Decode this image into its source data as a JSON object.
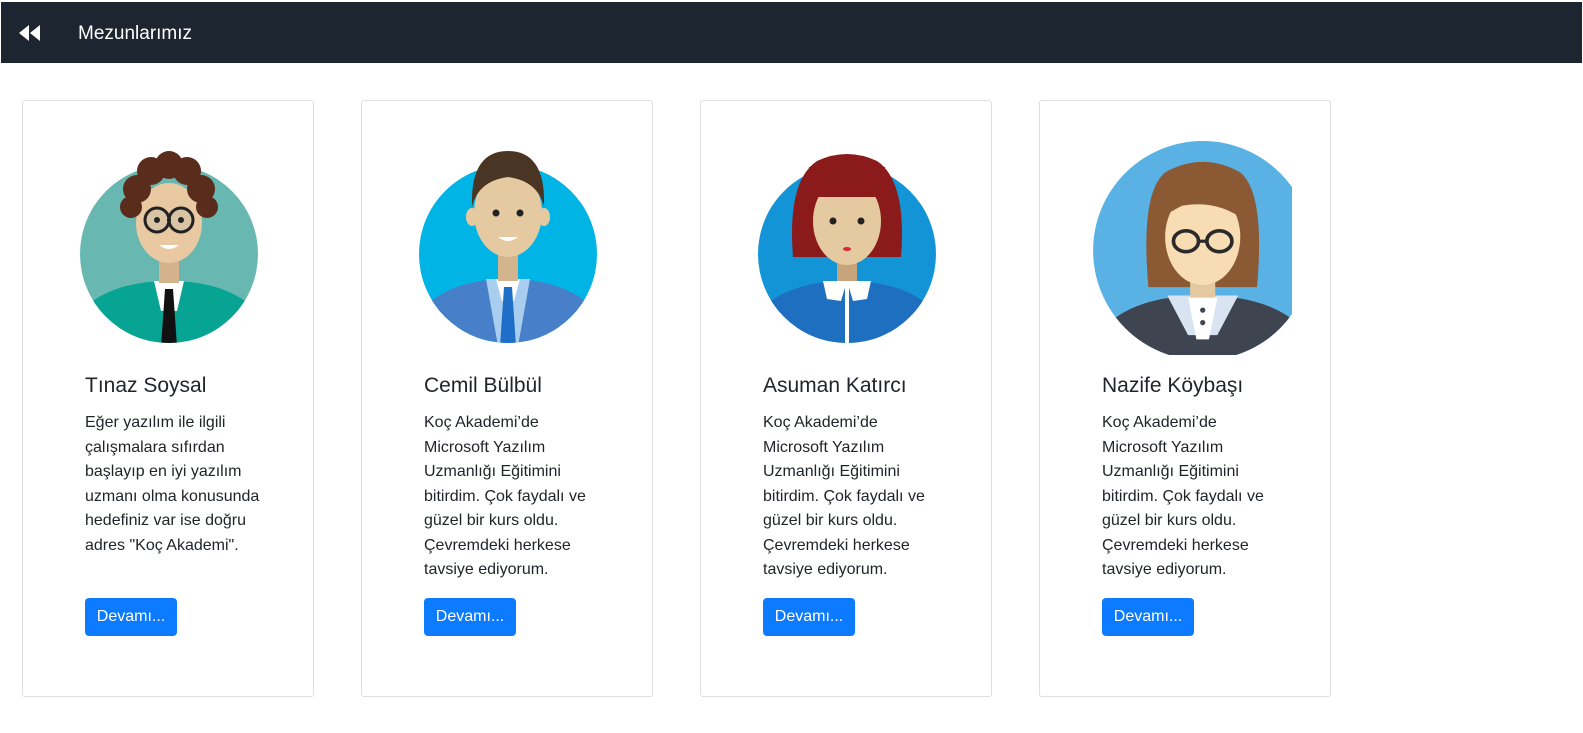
{
  "navbar": {
    "back_icon": "rewind-icon",
    "title": "Mezunlarımız"
  },
  "cards": [
    {
      "avatar_icon": "graduate-avatar-curly-hair-glasses-icon",
      "name": "Tınaz Soysal",
      "text": "Eğer yazılım ile ilgili çalışmalara sıfırdan başlayıp en iyi yazılım uzmanı olma konusunda hedefiniz var ise doğru adres \"Koç Akademi\".",
      "button": "Devamı..."
    },
    {
      "avatar_icon": "graduate-avatar-man-suit-icon",
      "name": "Cemil Bülbül",
      "text": "Koç Akademi’de Microsoft Yazılım Uzmanlığı Eğitimini bitirdim. Çok faydalı ve güzel bir kurs oldu. Çevremdeki herkese tavsiye ediyorum.",
      "button": "Devamı..."
    },
    {
      "avatar_icon": "graduate-avatar-woman-red-hair-icon",
      "name": "Asuman Katırcı",
      "text": "Koç Akademi’de Microsoft Yazılım Uzmanlığı Eğitimini bitirdim. Çok faydalı ve güzel bir kurs oldu. Çevremdeki herkese tavsiye ediyorum.",
      "button": "Devamı..."
    },
    {
      "avatar_icon": "graduate-avatar-woman-glasses-icon",
      "name": "Nazife Köybaşı",
      "text": "Koç Akademi’de Microsoft Yazılım Uzmanlığı Eğitimini bitirdim. Çok faydalı ve güzel bir kurs oldu. Çevremdeki herkese tavsiye ediyorum.",
      "button": "Devamı..."
    }
  ],
  "colors": {
    "navbar_bg": "#1d2530",
    "button_bg": "#0d7bff",
    "card_border": "#dfdfdf"
  }
}
